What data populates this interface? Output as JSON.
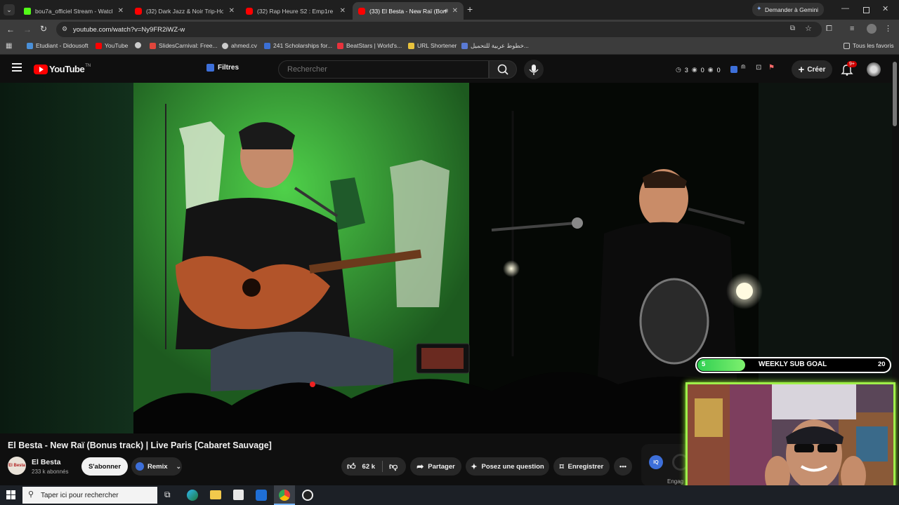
{
  "browser": {
    "tabs": [
      {
        "title": "bou7a_officiel Stream - Watch Li",
        "favicon_color": "#53fc18",
        "active": false
      },
      {
        "title": "(32) Dark Jazz & Noir Trip-Hop",
        "favicon_color": "#ff0000",
        "active": false
      },
      {
        "title": "(32) Rap Heure S2 : Emp1re - Vi",
        "favicon_color": "#ff0000",
        "active": false
      },
      {
        "title": "(33) El Besta - New Raï (Bon",
        "favicon_color": "#ff0000",
        "active": true
      }
    ],
    "new_tab": "+",
    "gemini_label": "Demander à Gemini",
    "url": "youtube.com/watch?v=Ny9FR2iWZ-w",
    "bookmarks": [
      {
        "label": "Etudiant - Didousoft",
        "color": "#4a90d9"
      },
      {
        "label": "YouTube",
        "color": "#ff0000"
      },
      {
        "label": "",
        "color": "#cccccc"
      },
      {
        "label": "SlidesCarnival: Free...",
        "color": "#e0463c"
      },
      {
        "label": "ahmed.cv",
        "color": "#cccccc"
      },
      {
        "label": "241 Scholarships for...",
        "color": "#3b6fd4"
      },
      {
        "label": "BeatStars | World's...",
        "color": "#e8323c"
      },
      {
        "label": "URL Shortener",
        "color": "#e8c23c"
      },
      {
        "label": "خطوط عربية للتحميل...",
        "color": "#5a7ad4"
      }
    ],
    "all_bookmarks": "Tous les favoris"
  },
  "youtube": {
    "logo": "YouTube",
    "country": "TN",
    "filters_label": "Filtres",
    "search_placeholder": "Rechercher",
    "stats": {
      "a": "3",
      "b": "0",
      "c": "0"
    },
    "create_label": "Créer",
    "notif_badge": "9+"
  },
  "video": {
    "title": "El Besta - New Raï (Bonus track) | Live Paris [Cabaret Sauvage]",
    "channel": "El Besta",
    "channel_avatar_text": "El Besta",
    "subscribers": "233 k abonnés",
    "subscribe_label": "S'abonner",
    "remix_label": "Remix",
    "likes": "62 k",
    "share_label": "Partager",
    "ask_label": "Posez une question",
    "save_label": "Enregistrer",
    "engage_label": "Engag"
  },
  "overlay": {
    "goal_current": "5",
    "goal_label": "WEEKLY SUB GOAL",
    "goal_target": "20",
    "goal_progress": 0.25
  },
  "taskbar": {
    "search_placeholder": "Taper ici pour rechercher"
  }
}
